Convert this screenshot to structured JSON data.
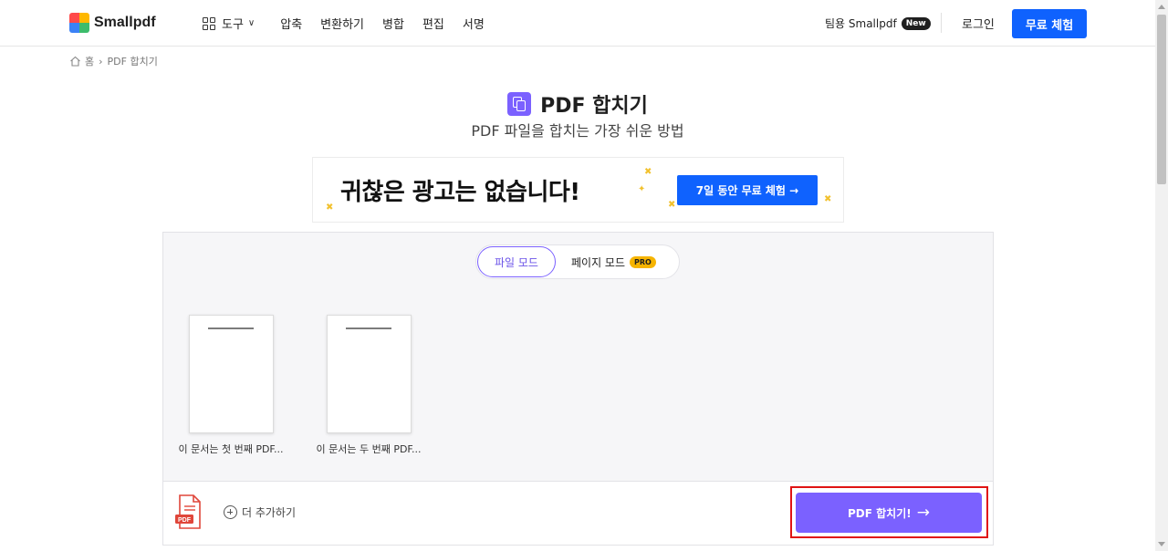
{
  "header": {
    "logo_text": "Smallpdf",
    "logo_colors": [
      "#ff4a4a",
      "#ffb800",
      "#3dbc6c",
      "#3b82f6"
    ],
    "nav": {
      "tools_label": "도구",
      "links": [
        "압축",
        "변환하기",
        "병합",
        "편집",
        "서명"
      ]
    },
    "team_label": "팀용 Smallpdf",
    "new_badge": "New",
    "login_label": "로그인",
    "free_trial_label": "무료 체험"
  },
  "breadcrumb": {
    "home_label": "홈",
    "current_label": "PDF 합치기"
  },
  "hero": {
    "title": "PDF 합치기",
    "subtitle": "PDF 파일을 합치는 가장 쉬운 방법"
  },
  "ad": {
    "headline": "귀찮은 광고는 없습니다!",
    "button_label": "7일 동안 무료 체험 →"
  },
  "workspace": {
    "mode_file_label": "파일 모드",
    "mode_page_label": "페이지 모드",
    "pro_badge": "PRO",
    "files": [
      {
        "name": "이 문서는 첫 번째 PDF..."
      },
      {
        "name": "이 문서는 두 번째 PDF..."
      }
    ]
  },
  "footer": {
    "add_more_label": "더 추가하기",
    "merge_button_label": "PDF 합치기!",
    "pdf_icon_label": "PDF"
  },
  "colors": {
    "accent": "#7b61ff",
    "primary_blue": "#0f62fe",
    "highlight_red": "#e01414"
  }
}
